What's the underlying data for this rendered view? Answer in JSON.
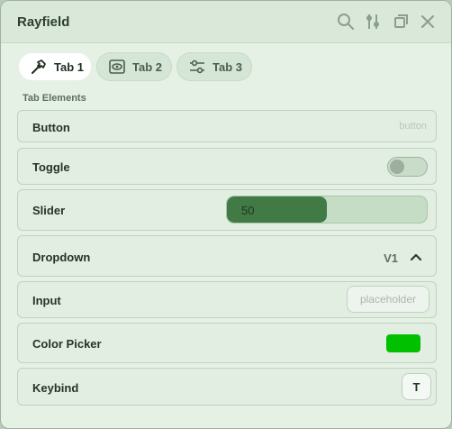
{
  "window": {
    "title": "Rayfield"
  },
  "titlebar_icons": [
    "search-icon",
    "settings-sliders-icon",
    "restore-window-icon",
    "close-icon"
  ],
  "tabs": [
    {
      "label": "Tab 1",
      "icon": "hammer-icon",
      "active": true
    },
    {
      "label": "Tab 2",
      "icon": "eye-icon",
      "active": false
    },
    {
      "label": "Tab 3",
      "icon": "sliders-icon",
      "active": false
    }
  ],
  "section": {
    "label": "Tab Elements"
  },
  "elements": {
    "button": {
      "label": "Button",
      "hint": "button"
    },
    "toggle": {
      "label": "Toggle",
      "on": false
    },
    "slider": {
      "label": "Slider",
      "value": "50",
      "fill_fraction": 0.5
    },
    "dropdown": {
      "label": "Dropdown",
      "value": "V1",
      "expanded": true
    },
    "input": {
      "label": "Input",
      "placeholder": "placeholder"
    },
    "color_picker": {
      "label": "Color Picker",
      "color": "#00c000"
    },
    "keybind": {
      "label": "Keybind",
      "key": "T"
    }
  }
}
